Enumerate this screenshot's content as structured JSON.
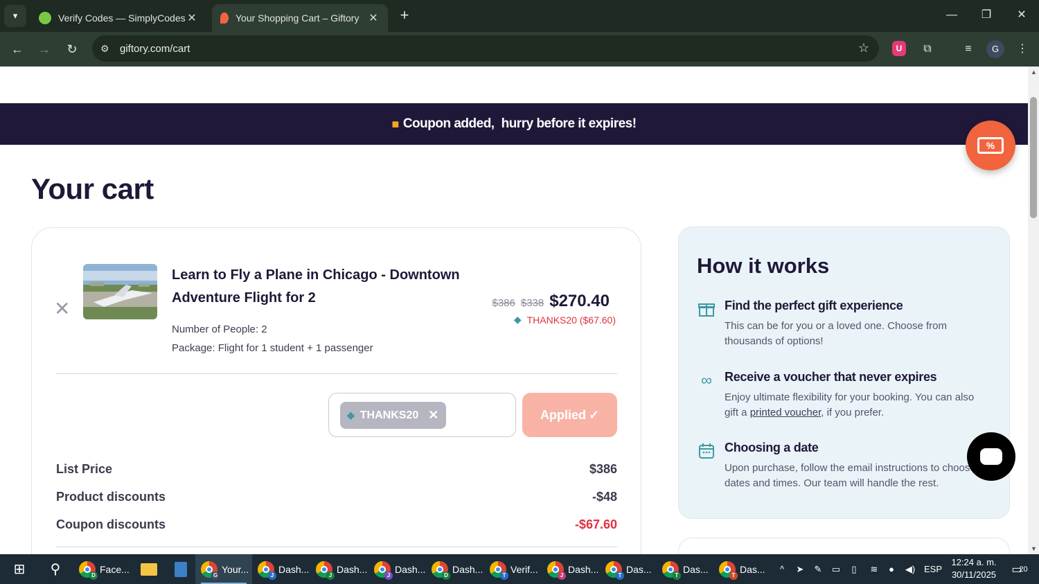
{
  "browser": {
    "tabs": [
      {
        "title": "Verify Codes — SimplyCodes",
        "active": false
      },
      {
        "title": "Your Shopping Cart – Giftory",
        "active": true
      }
    ],
    "url": "giftory.com/cart",
    "profile_initial": "G",
    "shield_letter": "U"
  },
  "banner": {
    "part1": "Coupon added,",
    "part2": "hurry before it expires!"
  },
  "page": {
    "title": "Your cart"
  },
  "cart": {
    "item": {
      "title": "Learn to Fly a Plane in Chicago - Downtown Adventure Flight for 2",
      "people": "Number of People: 2",
      "package": "Package: Flight for 1 student + 1 passenger",
      "price_original": "$386",
      "price_discounted": "$338",
      "price_final": "$270.40",
      "coupon_line": "THANKS20 ($67.60)"
    },
    "coupon": {
      "code": "THANKS20",
      "button_label": "Applied"
    },
    "summary": [
      {
        "label": "List Price",
        "value": "$386",
        "highlight": false
      },
      {
        "label": "Product discounts",
        "value": "-$48",
        "highlight": false
      },
      {
        "label": "Coupon discounts",
        "value": "-$67.60",
        "highlight": true
      }
    ]
  },
  "how_it_works": {
    "title": "How it works",
    "items": [
      {
        "icon": "gift-icon",
        "heading": "Find the perfect gift experience",
        "text": "This can be for you or a loved one. Choose from thousands of options!"
      },
      {
        "icon": "infinity-icon",
        "heading": "Receive a voucher that never expires",
        "text_before": "Enjoy ultimate flexibility for your booking. You can also gift a ",
        "link": "printed voucher",
        "text_after": ", if you prefer."
      },
      {
        "icon": "calendar-icon",
        "heading": "Choosing a date",
        "text": "Upon purchase, follow the email instructions to choose dates and times. Our team will handle the rest."
      }
    ]
  },
  "taskbar": {
    "items": [
      {
        "label": "Face...",
        "badge": "D",
        "badge_color": "#1a7f3c"
      },
      {
        "label": "Your...",
        "badge": "G",
        "badge_color": "#3f4a60",
        "active": true
      },
      {
        "label": "Dash...",
        "badge": "J",
        "badge_color": "#2b6cc4"
      },
      {
        "label": "Dash...",
        "badge": "J",
        "badge_color": "#1a7f3c"
      },
      {
        "label": "Dash...",
        "badge": "J",
        "badge_color": "#7b4bc4"
      },
      {
        "label": "Dash...",
        "badge": "D",
        "badge_color": "#1a7f3c"
      },
      {
        "label": "Verif...",
        "badge": "T",
        "badge_color": "#2b6cc4"
      },
      {
        "label": "Dash...",
        "badge": "J",
        "badge_color": "#c43b78"
      },
      {
        "label": "Das...",
        "badge": "T",
        "badge_color": "#2b6cc4"
      },
      {
        "label": "Das...",
        "badge": "T",
        "badge_color": "#1a7f3c"
      },
      {
        "label": "Das...",
        "badge": "T",
        "badge_color": "#d04a2a"
      }
    ],
    "language": "ESP",
    "time": "12:24 a. m.",
    "date": "30/11/2025",
    "notifications": "20"
  },
  "colors": {
    "banner_bg": "#1f1838",
    "coupon_red": "#e0313f",
    "applied_button": "#f8b3a6",
    "teal": "#3b9aa5"
  }
}
